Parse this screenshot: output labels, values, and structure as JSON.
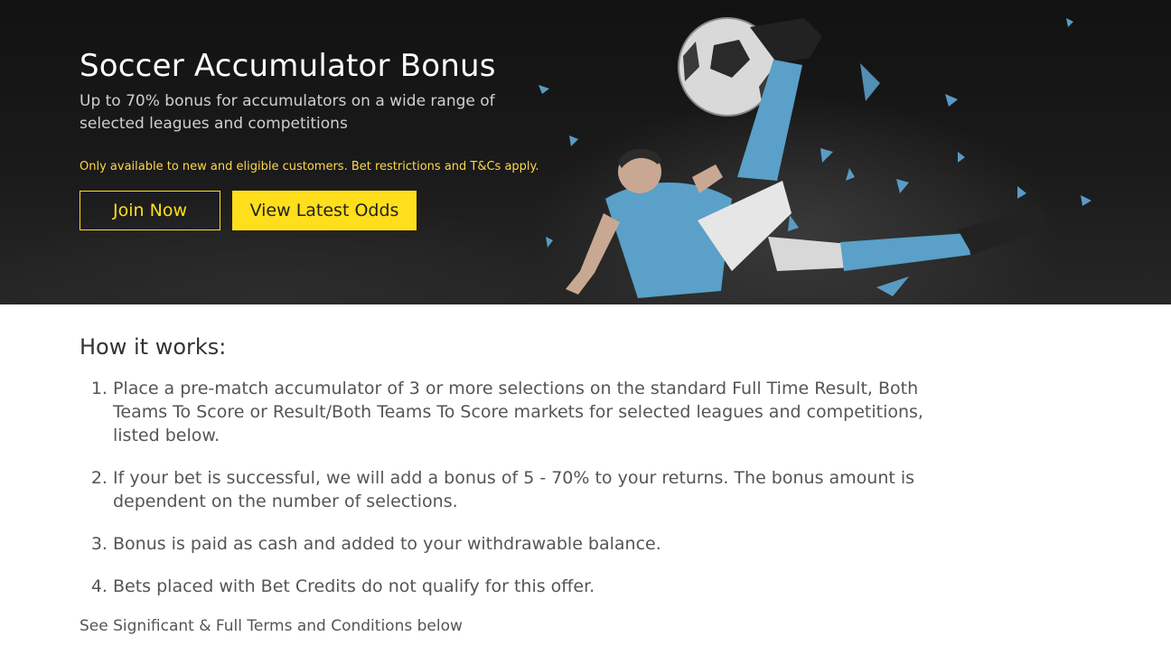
{
  "hero": {
    "title": "Soccer Accumulator Bonus",
    "subtitle": "Up to 70% bonus for accumulators on a wide range of selected leagues and competitions",
    "disclaimer": "Only available to new and eligible customers. Bet restrictions and T&Cs apply.",
    "join_label": "Join Now",
    "odds_label": "View Latest Odds",
    "colors": {
      "accent": "#ffdf1b",
      "disclaimer": "#ffd64a",
      "background": "#1a1a1a"
    }
  },
  "how_it_works": {
    "title": "How it works:",
    "steps": [
      "Place a pre-match accumulator of 3 or more selections on the standard Full Time Result, Both Teams To Score or Result/Both Teams To Score markets for selected leagues and competitions, listed below.",
      "If your bet is successful, we will add a bonus of 5 - 70% to your returns. The bonus amount is dependent on the number of selections.",
      "Bonus is paid as cash and added to your withdrawable balance.",
      "Bets placed with Bet Credits do not qualify for this offer."
    ],
    "terms_text": "See Significant & Full Terms and Conditions below"
  }
}
